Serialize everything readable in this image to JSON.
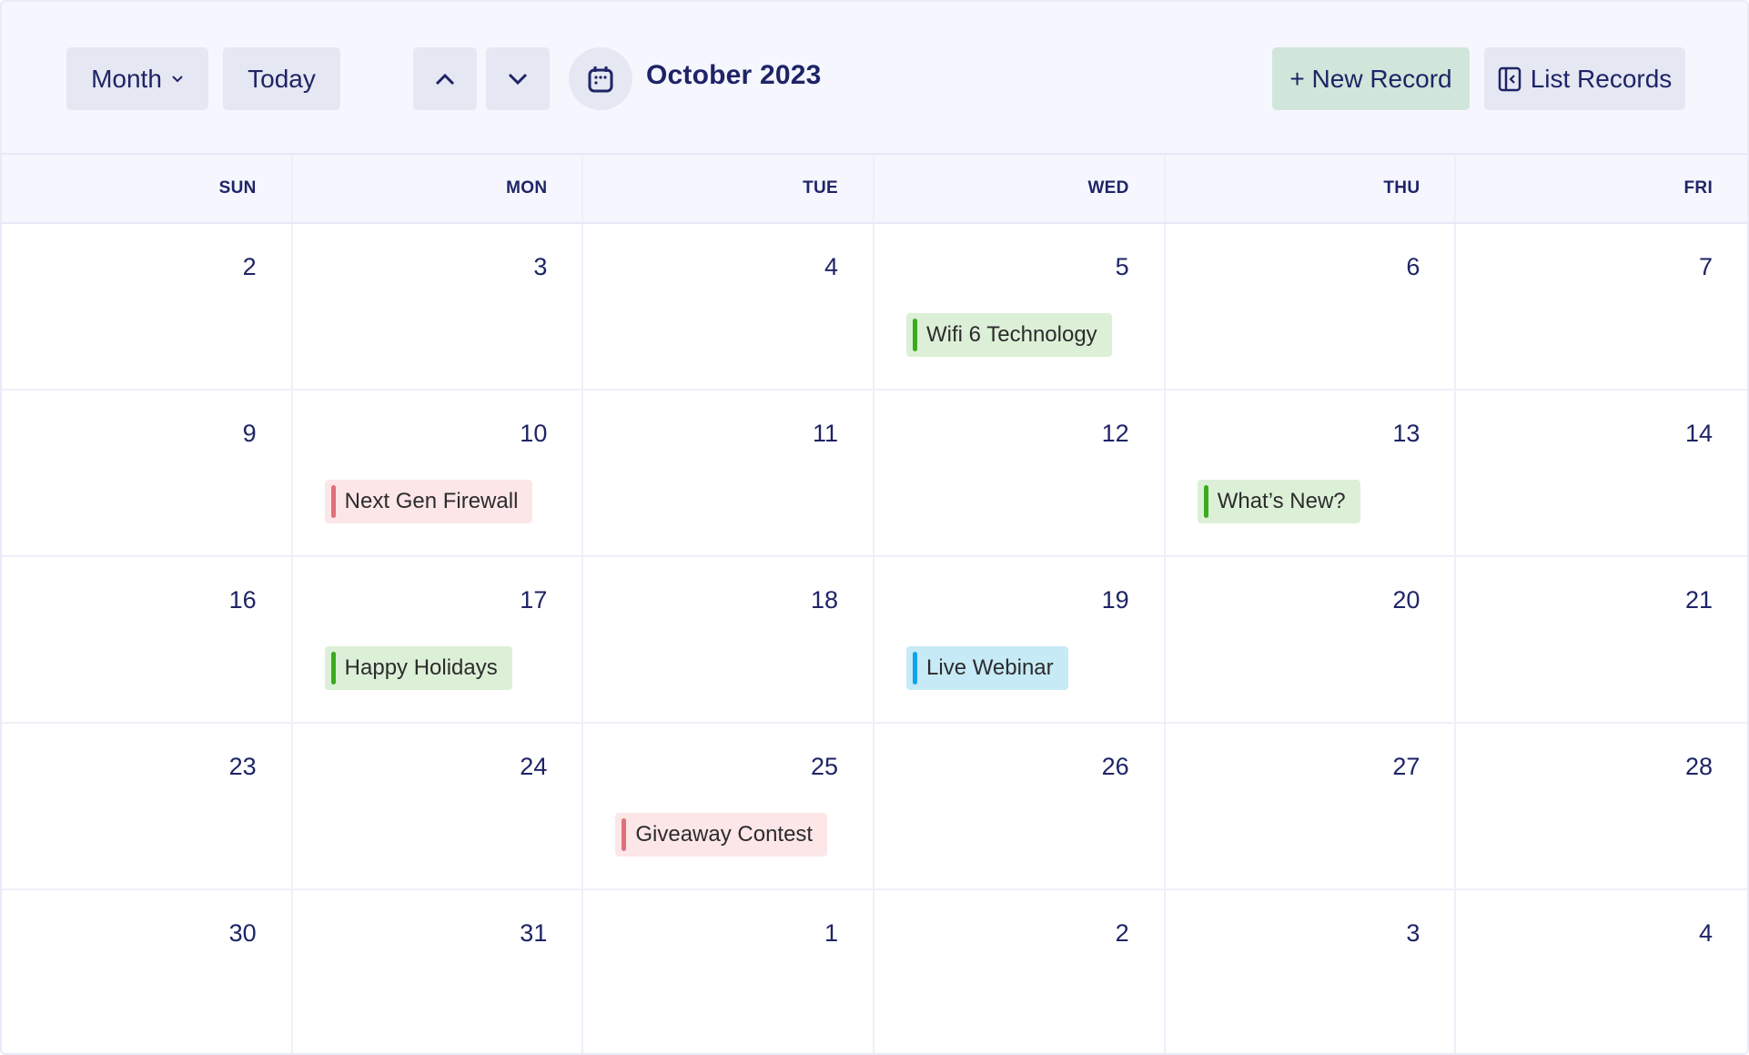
{
  "toolbar": {
    "view_selector": {
      "label": "Month",
      "icon": "chevron-down-icon"
    },
    "today_label": "Today",
    "prev_icon": "chevron-up-icon",
    "next_icon": "chevron-down-icon",
    "calendar_icon": "calendar-icon",
    "current_period": "October 2023",
    "new_record_label": "+ New Record",
    "list_records_label": "List Records",
    "list_records_icon": "sidebar-collapse-icon"
  },
  "colors": {
    "text": "#1e2466",
    "button_bg": "#e5e7f2",
    "new_record_bg": "#d1e6da",
    "green_bg": "#dcf0d7",
    "green_bar": "#3aaa1f",
    "red_bg": "#fde6e8",
    "red_bar": "#e0707a",
    "blue_bg": "#c7eaf7",
    "blue_bar": "#0ea5ea"
  },
  "weekdays": [
    "SUN",
    "MON",
    "TUE",
    "WED",
    "THU",
    "FRI"
  ],
  "weeks": [
    {
      "days": [
        {
          "num": "2"
        },
        {
          "num": "3"
        },
        {
          "num": "4"
        },
        {
          "num": "5",
          "event": {
            "title": "Wifi 6 Technology",
            "color": "green"
          }
        },
        {
          "num": "6"
        },
        {
          "num": "7"
        }
      ]
    },
    {
      "days": [
        {
          "num": "9"
        },
        {
          "num": "10",
          "event": {
            "title": "Next Gen Firewall",
            "color": "red"
          }
        },
        {
          "num": "11"
        },
        {
          "num": "12"
        },
        {
          "num": "13",
          "event": {
            "title": "What’s New?",
            "color": "green"
          }
        },
        {
          "num": "14"
        }
      ]
    },
    {
      "days": [
        {
          "num": "16"
        },
        {
          "num": "17",
          "event": {
            "title": "Happy Holidays",
            "color": "green"
          }
        },
        {
          "num": "18"
        },
        {
          "num": "19",
          "event": {
            "title": "Live Webinar",
            "color": "blue"
          }
        },
        {
          "num": "20"
        },
        {
          "num": "21"
        }
      ]
    },
    {
      "days": [
        {
          "num": "23"
        },
        {
          "num": "24"
        },
        {
          "num": "25",
          "event": {
            "title": "Giveaway Contest",
            "color": "red"
          }
        },
        {
          "num": "26"
        },
        {
          "num": "27"
        },
        {
          "num": "28"
        }
      ]
    },
    {
      "days": [
        {
          "num": "30"
        },
        {
          "num": "31"
        },
        {
          "num": "1"
        },
        {
          "num": "2"
        },
        {
          "num": "3"
        },
        {
          "num": "4"
        }
      ]
    }
  ]
}
